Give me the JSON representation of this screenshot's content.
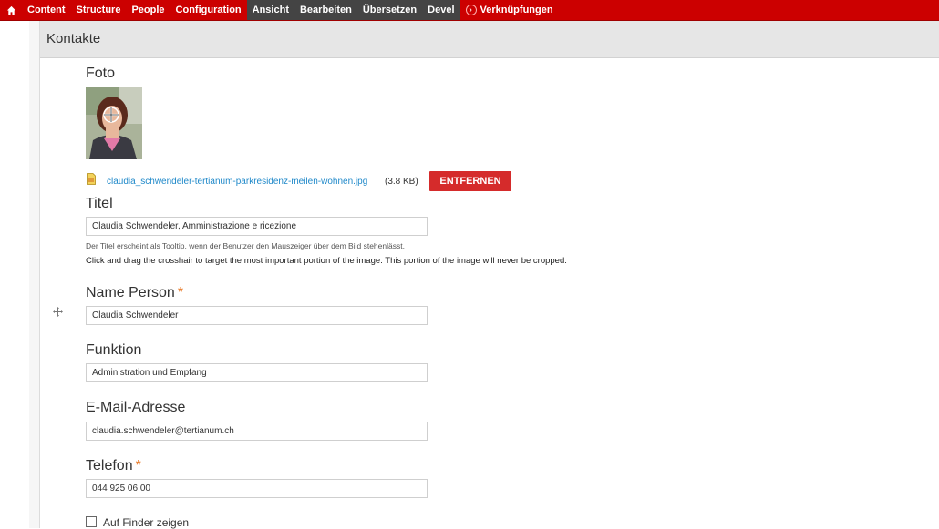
{
  "toolbar": {
    "items": [
      "Content",
      "Structure",
      "People",
      "Configuration"
    ],
    "dark_items": [
      "Ansicht",
      "Bearbeiten",
      "Übersetzen",
      "Devel"
    ],
    "shortcuts": "Verknüpfungen"
  },
  "page": {
    "title": "Kontakte"
  },
  "photo": {
    "label": "Foto",
    "filename": "claudia_schwendeler-tertianum-parkresidenz-meilen-wohnen.jpg",
    "filesize": "(3.8 KB)",
    "remove_label": "ENTFERNEN"
  },
  "titel": {
    "label": "Titel",
    "value": "Claudia Schwendeler, Amministrazione e ricezione",
    "help": "Der Titel erscheint als Tooltip, wenn der Benutzer den Mauszeiger über dem Bild stehenlässt.",
    "crop_help": "Click and drag the crosshair to target the most important portion of the image. This portion of the image will never be cropped."
  },
  "name_person": {
    "label": "Name Person",
    "required": "*",
    "value": "Claudia Schwendeler"
  },
  "funktion": {
    "label": "Funktion",
    "value": "Administration und Empfang"
  },
  "email": {
    "label": "E-Mail-Adresse",
    "value": "claudia.schwendeler@tertianum.ch"
  },
  "telefon": {
    "label": "Telefon",
    "required": "*",
    "value": "044 925 06 00"
  },
  "finder": {
    "label": "Auf Finder zeigen"
  },
  "colors": {
    "toolbar": "#cc0000",
    "remove_button": "#d52b2b",
    "link": "#1e88c9",
    "required": "#e87a29"
  }
}
